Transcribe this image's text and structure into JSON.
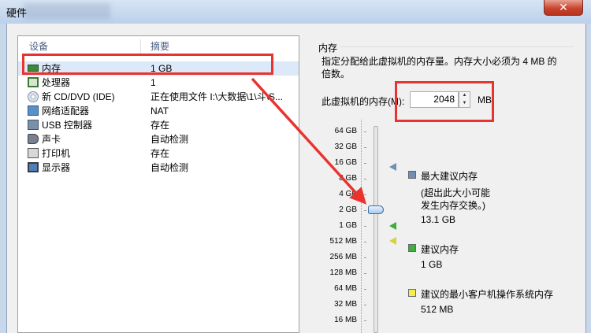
{
  "window": {
    "title": "硬件",
    "close_glyph": "✕"
  },
  "devices": {
    "col_device": "设备",
    "col_summary": "摘要",
    "items": [
      {
        "name": "内存",
        "summary": "1 GB",
        "icon": "memory-icon"
      },
      {
        "name": "处理器",
        "summary": "1",
        "icon": "processor-icon"
      },
      {
        "name": "新 CD/DVD (IDE)",
        "summary": "正在使用文件 I:\\大数据\\1\\斗\\S...",
        "icon": "cd-dvd-icon"
      },
      {
        "name": "网络适配器",
        "summary": "NAT",
        "icon": "network-adapter-icon"
      },
      {
        "name": "USB 控制器",
        "summary": "存在",
        "icon": "usb-icon"
      },
      {
        "name": "声卡",
        "summary": "自动检测",
        "icon": "sound-card-icon"
      },
      {
        "name": "打印机",
        "summary": "存在",
        "icon": "printer-icon"
      },
      {
        "name": "显示器",
        "summary": "自动检测",
        "icon": "display-icon"
      }
    ]
  },
  "memory": {
    "group_title": "内存",
    "description": "指定分配给此虚拟机的内存量。内存大小必须为 4 MB 的倍数。",
    "field_label": "此虚拟机的内存(M):",
    "value": "2048",
    "unit": "MB",
    "scale": [
      "64 GB",
      "32 GB",
      "16 GB",
      "8 GB",
      "4 GB",
      "2 GB",
      "1 GB",
      "512 MB",
      "256 MB",
      "128 MB",
      "64 MB",
      "32 MB",
      "16 MB"
    ],
    "slider_value_mb": 2048,
    "legend": {
      "max": {
        "title": "最大建议内存",
        "note1": "(超出此大小可能",
        "note2": "发生内存交换。)",
        "value": "13.1 GB",
        "color": "#6f8fb8"
      },
      "recommended": {
        "title": "建议内存",
        "value": "1 GB",
        "color": "#3fae3a"
      },
      "guest_min": {
        "title": "建议的最小客户机操作系统内存",
        "value": "512 MB",
        "color": "#f2ee4c"
      }
    }
  },
  "annotation": {
    "color": "#e8332e"
  }
}
